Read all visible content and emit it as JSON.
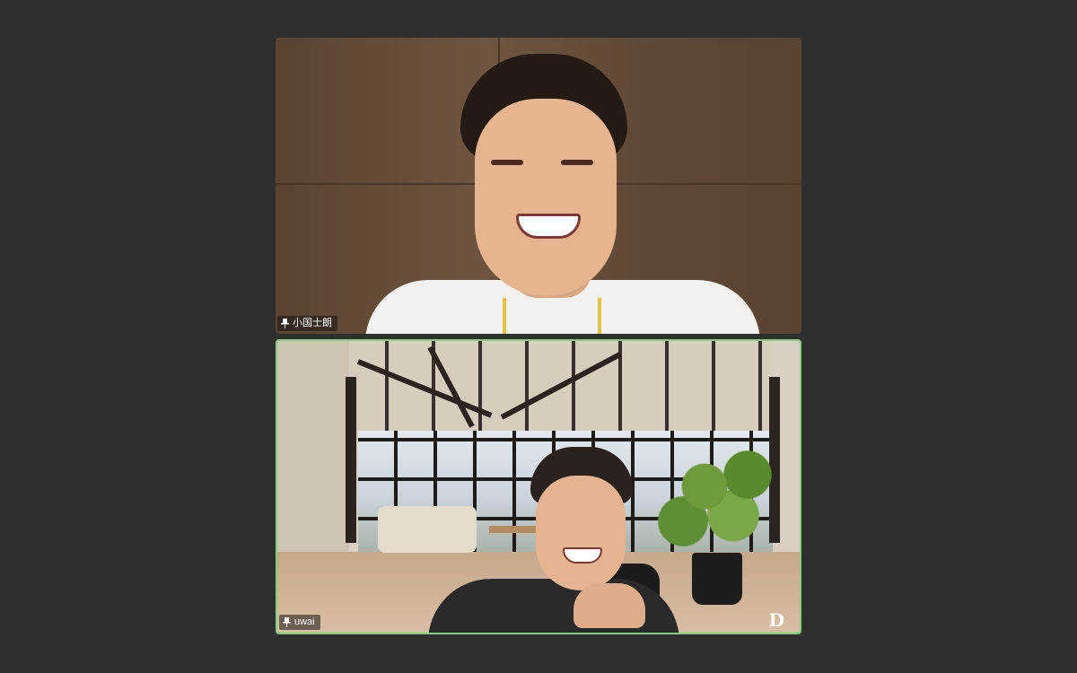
{
  "participants": [
    {
      "name": "小国士朗",
      "pinned": true,
      "active_speaker": false
    },
    {
      "name": "uwai",
      "pinned": true,
      "active_speaker": true
    }
  ],
  "watermark": {
    "text": "D"
  },
  "colors": {
    "background": "#2f2f2f",
    "active_speaker_border": "#7fd17a",
    "label_text": "#ffffff"
  },
  "icons": {
    "pin": "pin-icon"
  }
}
